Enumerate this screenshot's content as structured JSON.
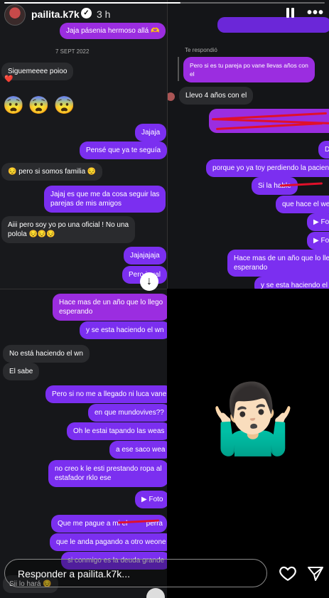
{
  "story": {
    "progress": 0.55,
    "username": "pailita.k7k",
    "verified_mark": "✓",
    "time_ago": "3 h",
    "icons": {
      "pause": "pause-icon",
      "more": "more-icon",
      "heart": "heart-icon",
      "send": "send-icon"
    },
    "more_label": "•••",
    "reply_placeholder": "Responder a pailita.k7k...",
    "sticker": "🤷🏻‍♂️"
  },
  "panel_top_left": {
    "top_bubble": "Jaja pásenia hermoso allá 🫶",
    "date": "7 SEPT 2022",
    "msg1": "Siguemeeee poioo",
    "msg1_reaction": "❤️",
    "emoji_row": "😨😨😨",
    "out1": "Jajaja",
    "out2": "Pensé que ya te seguía",
    "in2": "😔 pero si somos familia 😔",
    "out3_line1": "Jajaj es que me da cosa seguir las",
    "out3_line2": "parejas de mis amigos",
    "in3_line1": "Aiii pero soy yo po una oficial ! No una",
    "in3_line2": "polola 😔😔😔",
    "out4": "Jajajajaja",
    "out5": "Pero igual",
    "scroll_down": "↓"
  },
  "panel_top_right": {
    "replied_label": "Te respondió",
    "quote_line1": "Pero si es tu pareja po vane llevas años con",
    "quote_line2": "el",
    "in1": "Llevo 4 años con el",
    "out1": "Di",
    "out2": "porque yo ya toy perdiendo la pacienc",
    "out3": "Si la hable",
    "out4": "que hace el weo",
    "photo1": "▶ Fo",
    "photo2": "▶ Fo",
    "out5_line1": "Hace mas de un año que lo lleg",
    "out5_line2": "esperando",
    "out6": "y se esta haciendo el w"
  },
  "panel_bottom_left": {
    "out1_line1": "Hace mas de un año que lo llego",
    "out1_line2": "esperando",
    "out2": "y se esta haciendo el wn",
    "in1": "No está haciendo el wn",
    "in2": "El sabe",
    "out3": "Pero si no me a llegado ni luca vane",
    "out4": "en que mundovives??",
    "out5": "Oh le estai tapando las weas",
    "out6": "a ese saco wea",
    "out7_line1": "no creo k le esti prestando ropa al",
    "out7_line2": "estafador rklo ese",
    "photo": "▶ Foto",
    "out8": "Que me pague a mi el",
    "out8_tail": "perra",
    "out9": "que le anda pagando a otro weone",
    "out10": "si conmigo es la deuda grande",
    "in3": "Sii lo hará 😔"
  }
}
